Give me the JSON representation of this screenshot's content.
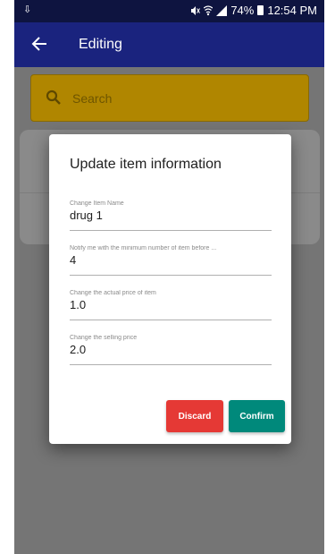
{
  "status_bar": {
    "left": "⇩",
    "battery": "74%",
    "time": "12:54 PM"
  },
  "app_bar": {
    "title": "Editing"
  },
  "search": {
    "placeholder": "Search"
  },
  "dialog": {
    "title": "Update item information",
    "fields": [
      {
        "label": "Change Item Name",
        "value": "drug 1"
      },
      {
        "label": "Notify me with the minimum number of item before ...",
        "value": "4"
      },
      {
        "label": "Change the actual price of item",
        "value": "1.0"
      },
      {
        "label": "Change the selling price",
        "value": "2.0"
      }
    ],
    "discard_label": "Discard",
    "confirm_label": "Confirm"
  },
  "colors": {
    "app_bar": "#1a237e",
    "search_bar": "#b08600",
    "discard": "#e53935",
    "confirm": "#00897b"
  }
}
